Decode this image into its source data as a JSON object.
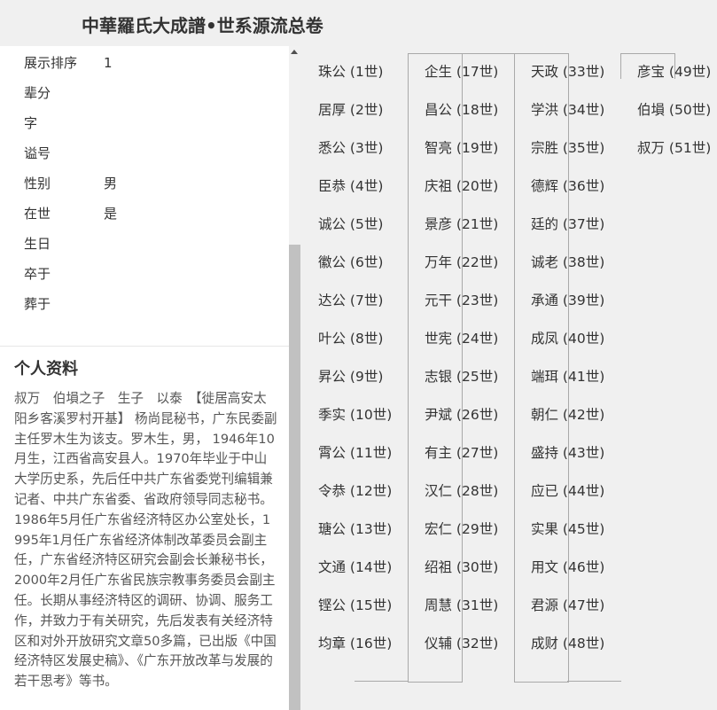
{
  "header": {
    "title": "中華羅氏大成譜•世系源流总卷"
  },
  "attributes": [
    {
      "key": "展示排序",
      "value": "1"
    },
    {
      "key": "辈分",
      "value": ""
    },
    {
      "key": "字",
      "value": ""
    },
    {
      "key": "谥号",
      "value": ""
    },
    {
      "key": "性别",
      "value": "男"
    },
    {
      "key": "在世",
      "value": "是"
    },
    {
      "key": "生日",
      "value": ""
    },
    {
      "key": "卒于",
      "value": ""
    },
    {
      "key": "葬于",
      "value": ""
    }
  ],
  "profile": {
    "title": "个人资料",
    "bio": "叔万　伯塤之子　生子　以泰　【徙居高安太阳乡客溪罗村开基】 杨尚昆秘书，广东民委副主任罗木生为该支。罗木生，男， 1946年10月生，江西省高安县人。1970年毕业于中山大学历史系，先后任中共广东省委党刊编辑兼记者、中共广东省委、省政府领导同志秘书。1986年5月任广东省经济特区办公室处长，1995年1月任广东省经济体制改革委员会副主任，广东省经济特区研究会副会长兼秘书长，2000年2月任广东省民族宗教事务委员会副主任。长期从事经济特区的调研、协调、服务工作，并致力于有关研究，先后发表有关经济特区和对外开放研究文章50多篇，已出版《中国经济特区发展史稿》、《广东开放改革与发展的若干思考》等书。"
  },
  "lineage": [
    [
      "珠公 (1世)",
      "居厚 (2世)",
      "悉公 (3世)",
      "臣恭 (4世)",
      "诚公 (5世)",
      "徽公 (6世)",
      "达公 (7世)",
      "叶公 (8世)",
      "昇公 (9世)",
      "季实 (10世)",
      "霄公 (11世)",
      "令恭 (12世)",
      "瑭公 (13世)",
      "文通 (14世)",
      "铿公 (15世)",
      "均章 (16世)"
    ],
    [
      "企生 (17世)",
      "昌公 (18世)",
      "智亮 (19世)",
      "庆祖 (20世)",
      "景彦 (21世)",
      "万年 (22世)",
      "元干 (23世)",
      "世宪 (24世)",
      "志银 (25世)",
      "尹斌 (26世)",
      "有主 (27世)",
      "汉仁 (28世)",
      "宏仁 (29世)",
      "绍祖 (30世)",
      "周慧 (31世)",
      "仪辅 (32世)"
    ],
    [
      "天政 (33世)",
      "学洪 (34世)",
      "宗胜 (35世)",
      "德辉 (36世)",
      "廷的 (37世)",
      "诚老 (38世)",
      "承通 (39世)",
      "成凤 (40世)",
      "端珥 (41世)",
      "朝仁 (42世)",
      "盛持 (43世)",
      "应已 (44世)",
      "实果 (45世)",
      "用文 (46世)",
      "君源 (47世)",
      "成财 (48世)"
    ],
    [
      "彦宝 (49世)",
      "伯塤 (50世)",
      "叔万 (51世)"
    ]
  ]
}
